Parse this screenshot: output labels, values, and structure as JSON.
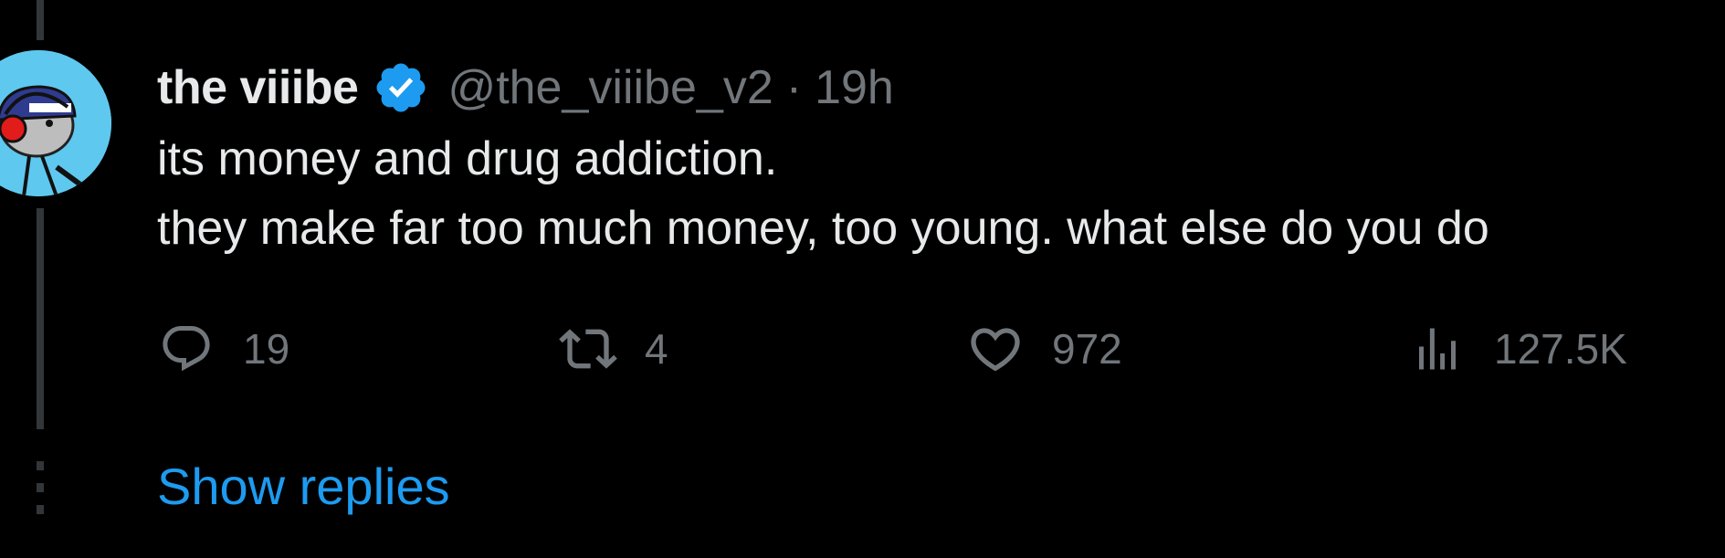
{
  "tweet": {
    "author_name": "the viiibe",
    "handle": "@the_viiibe_v2",
    "separator": "·",
    "time": "19h",
    "verified_icon": "verified-badge-icon",
    "text_lines": [
      "its money and drug addiction.",
      "they make far too much money, too young. what else do you do"
    ]
  },
  "actions": {
    "reply": {
      "icon": "reply-icon",
      "count": "19"
    },
    "retweet": {
      "icon": "retweet-icon",
      "count": "4"
    },
    "like": {
      "icon": "heart-icon",
      "count": "972"
    },
    "views": {
      "icon": "views-icon",
      "count": "127.5K"
    }
  },
  "show_replies_label": "Show replies",
  "colors": {
    "background": "#000000",
    "text_primary": "#e7e9ea",
    "text_secondary": "#71767b",
    "accent": "#1d9bf0",
    "thread_line": "#333639"
  }
}
